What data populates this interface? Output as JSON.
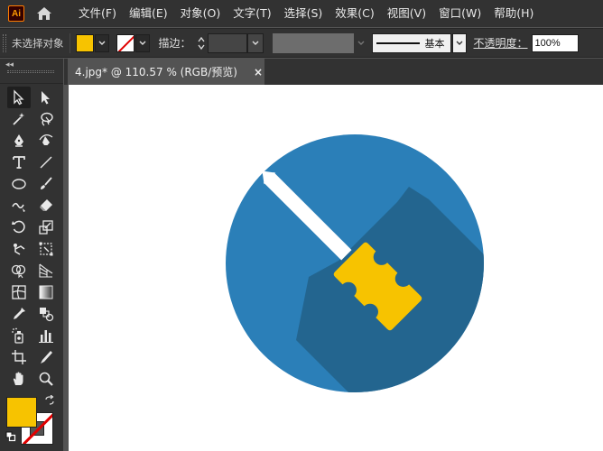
{
  "app": {
    "logo_text": "Ai"
  },
  "menu": {
    "items": [
      "文件(F)",
      "编辑(E)",
      "对象(O)",
      "文字(T)",
      "选择(S)",
      "效果(C)",
      "视图(V)",
      "窗口(W)",
      "帮助(H)"
    ]
  },
  "control_bar": {
    "selection_status": "未选择对象",
    "stroke_label": "描边：",
    "brush_name": "基本",
    "opacity_label": "不透明度：",
    "opacity_value": "100%"
  },
  "document": {
    "tab_title": "4.jpg* @ 110.57 % (RGB/预览)",
    "close_glyph": "×"
  },
  "colors": {
    "fill": "#f7c300",
    "circle_bg": "#2b7fb8",
    "shadow": "#23658f",
    "shaft": "#ffffff"
  },
  "tools": [
    "selection-tool",
    "direct-selection-tool",
    "magic-wand-tool",
    "lasso-tool",
    "pen-tool",
    "curvature-tool",
    "type-tool",
    "line-segment-tool",
    "ellipse-tool",
    "paintbrush-tool",
    "shaper-tool",
    "eraser-tool",
    "rotate-tool",
    "scale-tool",
    "puppet-warp-tool",
    "free-transform-tool",
    "shape-builder-tool",
    "perspective-grid-tool",
    "mesh-tool",
    "gradient-tool",
    "eyedropper-tool",
    "blend-tool",
    "symbol-sprayer-tool",
    "column-graph-tool",
    "artboard-tool",
    "slice-tool",
    "hand-tool",
    "zoom-tool"
  ]
}
